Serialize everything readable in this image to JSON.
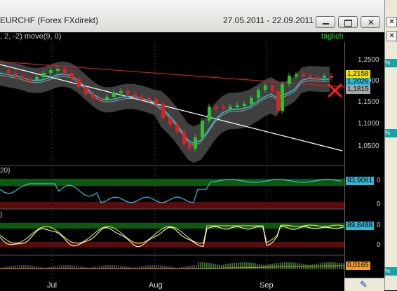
{
  "window": {
    "title": "EURCHF (Forex FXdirekt)",
    "date_range": "27.05.2011 - 22.09.2011"
  },
  "indicator_header": ", 2, -2) move(9, 0)",
  "period_label": "täglich",
  "price_axis": {
    "ticks": [
      "1,2500",
      "1,2000",
      "1,1500",
      "1,1000",
      "1,0500"
    ],
    "tags": [
      {
        "label": "1,2158",
        "bg": "#f0e200",
        "fg": "#000000"
      },
      {
        "label": "1,2026",
        "bg": "#36b7d6",
        "fg": "#000000"
      },
      {
        "label": "1,1815",
        "bg": "#a8a8a8",
        "fg": "#000000"
      }
    ]
  },
  "panel1": {
    "title": "20)",
    "value": "93,9081",
    "value_bg": "#36b7d6",
    "ticks": [
      "0",
      "0"
    ]
  },
  "panel2": {
    "title": ")",
    "value": "89,8488",
    "value_bg": "#36b7d6",
    "ticks": [
      "0",
      "0"
    ]
  },
  "panel3": {
    "value": "0,0165",
    "value_bg": "#f2a020"
  },
  "x_axis": {
    "labels": [
      "Jul",
      "Aug",
      "Sep"
    ]
  },
  "right_strip": {
    "labels": [
      "%",
      "%",
      "%"
    ]
  },
  "colors": {
    "bull": "#27c427",
    "bear": "#e02020",
    "band": "#4a4a4a",
    "ma": "#36c0e0",
    "trend_white": "#ffffff",
    "trend_red": "#d02020"
  },
  "chart_data": {
    "type": "candlestick",
    "x_labels": [
      "Jul",
      "Aug",
      "Sep"
    ],
    "y_ticks": [
      1.25,
      1.2,
      1.15,
      1.1,
      1.05
    ],
    "ylim": [
      1.0,
      1.28
    ],
    "last_close": 1.2158,
    "moving_average_last": 1.2026,
    "lower_band_last": 1.1815
  }
}
